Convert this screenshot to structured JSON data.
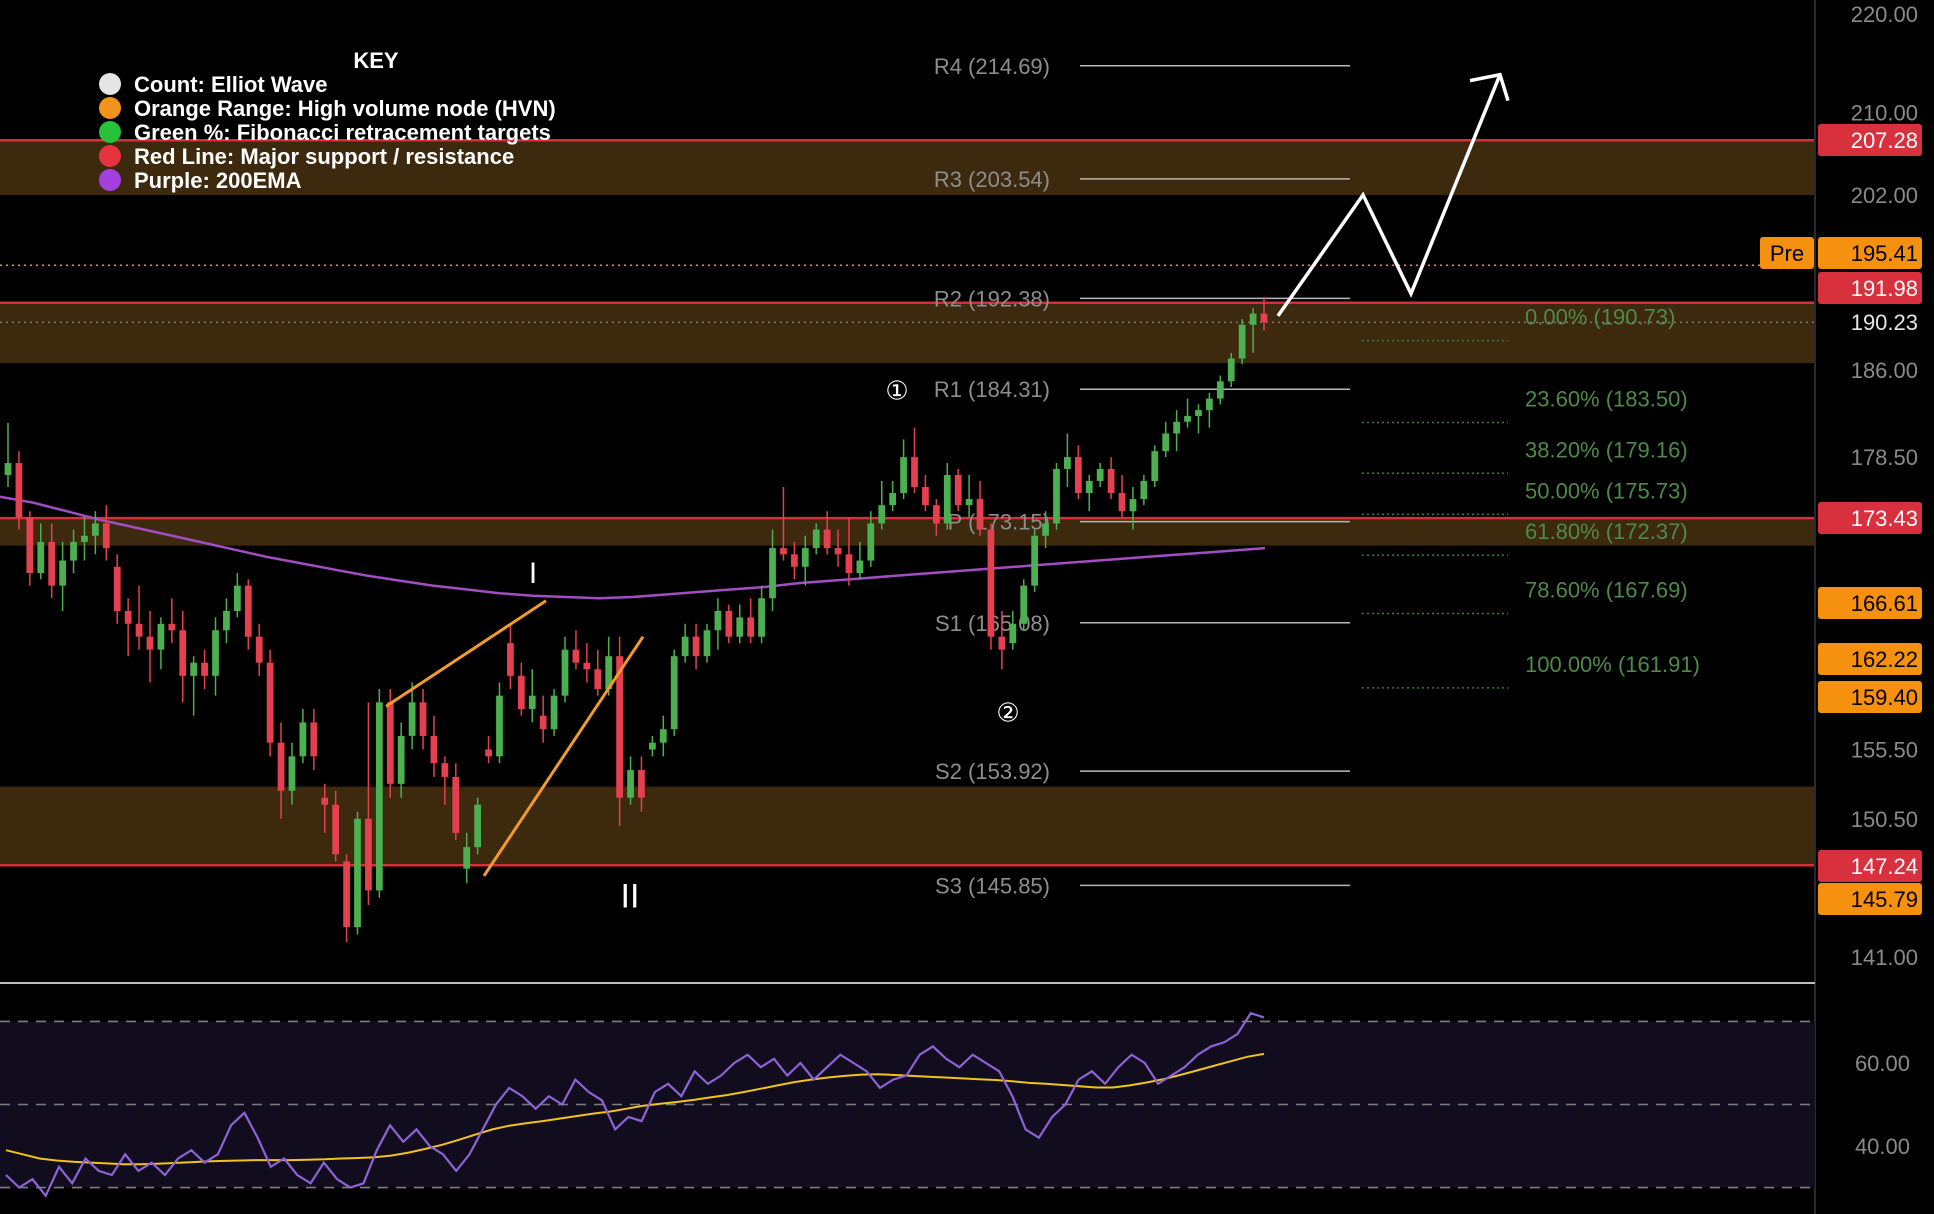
{
  "key": {
    "title": "KEY",
    "items": [
      {
        "color": "#e6e6e6",
        "label": "Count: Elliot Wave"
      },
      {
        "color": "#f2931c",
        "label": "Orange Range: High volume node (HVN)"
      },
      {
        "color": "#27c13a",
        "label": "Green %: Fibonacci retracement targets"
      },
      {
        "color": "#e5333f",
        "label": "Red Line: Major support / resistance"
      },
      {
        "color": "#a43fe0",
        "label": "Purple: 200EMA"
      }
    ]
  },
  "chart_data": {
    "type": "candlestick",
    "price_axis": {
      "ticks": [
        "220.00",
        "210.00",
        "202.00",
        "186.00",
        "178.50",
        "155.50",
        "150.50",
        "141.00"
      ],
      "scale": "log"
    },
    "badges": [
      {
        "value": "207.28",
        "style": "red"
      },
      {
        "value": "195.41",
        "style": "orange",
        "prefix": "Pre"
      },
      {
        "value": "191.98",
        "style": "red"
      },
      {
        "value": "190.23",
        "style": "plain"
      },
      {
        "value": "173.43",
        "style": "red"
      },
      {
        "value": "166.61",
        "style": "orange"
      },
      {
        "value": "162.22",
        "style": "orange"
      },
      {
        "value": "159.40",
        "style": "orange"
      },
      {
        "value": "147.24",
        "style": "red"
      },
      {
        "value": "145.79",
        "style": "orange"
      }
    ],
    "pivots": [
      {
        "label": "R4 (214.69)",
        "value": 214.69
      },
      {
        "label": "R3 (203.54)",
        "value": 203.54
      },
      {
        "label": "R2 (192.38)",
        "value": 192.38
      },
      {
        "label": "R1 (184.31)",
        "value": 184.31
      },
      {
        "label": "P (173.15)",
        "value": 173.15
      },
      {
        "label": "S1 (165.08)",
        "value": 165.08
      },
      {
        "label": "S2 (153.92)",
        "value": 153.92
      },
      {
        "label": "S3 (145.85)",
        "value": 145.85
      }
    ],
    "fibonacci": [
      {
        "label": "0.00% (190.73)",
        "value": 190.73
      },
      {
        "label": "23.60% (183.50)",
        "value": 183.5
      },
      {
        "label": "38.20% (179.16)",
        "value": 179.16
      },
      {
        "label": "50.00% (175.73)",
        "value": 175.73
      },
      {
        "label": "61.80% (172.37)",
        "value": 172.37
      },
      {
        "label": "78.60% (167.69)",
        "value": 167.69
      },
      {
        "label": "100.00% (161.91)",
        "value": 161.91
      }
    ],
    "support_resistance": [
      207.28,
      191.98,
      173.43,
      147.24
    ],
    "hvn_zones": [
      [
        202.0,
        207.28
      ],
      [
        186.6,
        191.98
      ],
      [
        171.2,
        173.43
      ],
      [
        147.24,
        152.8
      ]
    ],
    "premarket_price": 195.41,
    "last_price": 190.23,
    "wave_labels": [
      {
        "text": "I",
        "price": 169.0
      },
      {
        "text": "II",
        "price": 145.0
      },
      {
        "text": "①",
        "price": 184.3
      },
      {
        "text": "②",
        "price": 158.3
      }
    ],
    "candles": [
      [
        177.0,
        181.4,
        176.0,
        178.0
      ],
      [
        178.0,
        179.0,
        172.5,
        173.5
      ],
      [
        173.5,
        174.0,
        168.0,
        169.0
      ],
      [
        169.0,
        173.0,
        168.5,
        171.5
      ],
      [
        171.5,
        173.0,
        167.0,
        168.0
      ],
      [
        168.0,
        171.5,
        166.0,
        170.0
      ],
      [
        170.0,
        172.5,
        169.0,
        171.5
      ],
      [
        171.5,
        173.5,
        170.0,
        172.0
      ],
      [
        172.0,
        174.0,
        170.5,
        173.0
      ],
      [
        173.0,
        174.5,
        170.0,
        171.0
      ],
      [
        169.5,
        170.5,
        165.0,
        166.0
      ],
      [
        166.0,
        167.0,
        162.5,
        165.0
      ],
      [
        165.0,
        168.0,
        163.0,
        164.0
      ],
      [
        164.0,
        166.0,
        160.5,
        163.0
      ],
      [
        163.0,
        165.5,
        161.5,
        165.0
      ],
      [
        165.0,
        167.0,
        163.5,
        164.5
      ],
      [
        164.5,
        166.0,
        159.0,
        161.0
      ],
      [
        161.0,
        162.5,
        158.0,
        162.0
      ],
      [
        162.0,
        163.0,
        160.0,
        161.0
      ],
      [
        161.0,
        165.5,
        159.5,
        164.5
      ],
      [
        164.5,
        167.0,
        163.5,
        166.0
      ],
      [
        166.0,
        169.0,
        165.5,
        168.0
      ],
      [
        168.0,
        168.5,
        163.0,
        164.0
      ],
      [
        164.0,
        165.0,
        161.0,
        162.0
      ],
      [
        162.0,
        163.0,
        155.0,
        156.0
      ],
      [
        156.0,
        157.5,
        150.5,
        152.5
      ],
      [
        152.5,
        156.0,
        151.5,
        155.0
      ],
      [
        155.0,
        158.5,
        154.5,
        157.5
      ],
      [
        157.5,
        158.5,
        154.0,
        155.0
      ],
      [
        152.0,
        153.0,
        149.5,
        151.5
      ],
      [
        151.5,
        152.5,
        147.5,
        148.0
      ],
      [
        147.5,
        148.0,
        142.0,
        143.0
      ],
      [
        143.0,
        151.0,
        142.5,
        150.5
      ],
      [
        150.5,
        159.0,
        144.5,
        145.5
      ],
      [
        145.5,
        160.0,
        145.0,
        159.0
      ],
      [
        159.0,
        160.0,
        152.0,
        153.0
      ],
      [
        153.0,
        157.5,
        152.0,
        156.5
      ],
      [
        156.5,
        160.5,
        155.5,
        159.0
      ],
      [
        159.0,
        160.0,
        155.5,
        156.5
      ],
      [
        156.5,
        158.0,
        153.5,
        154.5
      ],
      [
        154.5,
        155.0,
        151.5,
        153.5
      ],
      [
        153.5,
        154.5,
        149.0,
        149.5
      ],
      [
        147.0,
        149.5,
        146.0,
        148.5
      ],
      [
        148.5,
        152.0,
        148.0,
        151.5
      ],
      [
        155.5,
        156.5,
        154.5,
        155.0
      ],
      [
        155.0,
        160.5,
        154.5,
        159.5
      ],
      [
        163.5,
        165.0,
        160.0,
        161.0
      ],
      [
        161.0,
        162.0,
        158.0,
        158.5
      ],
      [
        158.5,
        161.5,
        157.5,
        159.5
      ],
      [
        158.0,
        159.5,
        156.0,
        157.0
      ],
      [
        157.0,
        160.0,
        156.5,
        159.5
      ],
      [
        159.5,
        164.0,
        159.0,
        163.0
      ],
      [
        163.0,
        164.5,
        161.5,
        162.0
      ],
      [
        162.0,
        163.5,
        160.5,
        161.5
      ],
      [
        161.5,
        163.0,
        159.5,
        160.0
      ],
      [
        160.0,
        164.0,
        159.5,
        162.5
      ],
      [
        162.5,
        164.0,
        150.0,
        152.0
      ],
      [
        152.0,
        155.0,
        151.5,
        154.0
      ],
      [
        154.0,
        155.0,
        151.0,
        152.0
      ],
      [
        155.5,
        156.5,
        155.0,
        156.0
      ],
      [
        156.0,
        158.0,
        155.0,
        157.0
      ],
      [
        157.0,
        163.0,
        156.5,
        162.5
      ],
      [
        162.5,
        165.0,
        162.0,
        164.0
      ],
      [
        164.0,
        165.0,
        161.5,
        162.5
      ],
      [
        162.5,
        165.0,
        162.0,
        164.5
      ],
      [
        164.5,
        167.0,
        163.0,
        166.0
      ],
      [
        166.0,
        166.5,
        163.5,
        164.0
      ],
      [
        164.0,
        166.5,
        163.5,
        165.5
      ],
      [
        165.5,
        167.0,
        163.5,
        164.0
      ],
      [
        164.0,
        168.0,
        163.5,
        167.0
      ],
      [
        167.0,
        172.5,
        166.0,
        171.0
      ],
      [
        171.0,
        176.0,
        170.0,
        170.5
      ],
      [
        170.5,
        171.5,
        168.5,
        169.5
      ],
      [
        169.5,
        172.0,
        168.0,
        171.0
      ],
      [
        171.0,
        173.0,
        170.5,
        172.5
      ],
      [
        172.5,
        174.0,
        170.5,
        171.0
      ],
      [
        171.0,
        172.5,
        169.5,
        170.5
      ],
      [
        170.5,
        173.5,
        168.0,
        169.0
      ],
      [
        169.0,
        171.5,
        168.5,
        170.0
      ],
      [
        170.0,
        174.0,
        169.5,
        173.0
      ],
      [
        173.0,
        176.5,
        172.5,
        174.5
      ],
      [
        174.5,
        176.5,
        174.0,
        175.5
      ],
      [
        175.5,
        180.0,
        175.0,
        178.5
      ],
      [
        178.5,
        181.0,
        175.5,
        176.0
      ],
      [
        176.0,
        177.0,
        174.0,
        174.5
      ],
      [
        174.5,
        175.0,
        172.0,
        173.0
      ],
      [
        173.0,
        178.0,
        172.5,
        177.0
      ],
      [
        177.0,
        177.5,
        174.0,
        174.5
      ],
      [
        174.5,
        177.0,
        173.5,
        175.0
      ],
      [
        175.0,
        176.5,
        172.0,
        172.5
      ],
      [
        172.5,
        173.0,
        163.0,
        164.0
      ],
      [
        164.0,
        166.0,
        161.5,
        163.0
      ],
      [
        163.5,
        166.0,
        163.0,
        165.0
      ],
      [
        165.0,
        168.5,
        164.5,
        168.0
      ],
      [
        168.0,
        172.5,
        167.5,
        172.0
      ],
      [
        172.0,
        174.0,
        171.0,
        173.0
      ],
      [
        173.0,
        178.0,
        172.5,
        177.5
      ],
      [
        177.5,
        180.5,
        176.0,
        178.5
      ],
      [
        178.5,
        179.5,
        175.0,
        175.5
      ],
      [
        175.5,
        177.0,
        174.0,
        176.5
      ],
      [
        176.5,
        178.0,
        176.0,
        177.5
      ],
      [
        177.5,
        178.5,
        175.0,
        175.5
      ],
      [
        175.5,
        177.0,
        173.5,
        174.0
      ],
      [
        174.0,
        176.0,
        172.5,
        175.0
      ],
      [
        175.0,
        177.0,
        174.5,
        176.5
      ],
      [
        176.5,
        179.5,
        176.0,
        179.0
      ],
      [
        179.0,
        181.5,
        178.5,
        180.5
      ],
      [
        180.5,
        182.5,
        179.0,
        181.5
      ],
      [
        181.5,
        183.5,
        181.0,
        182.0
      ],
      [
        182.0,
        183.0,
        180.5,
        182.5
      ],
      [
        182.5,
        184.0,
        181.0,
        183.5
      ],
      [
        183.5,
        185.5,
        183.0,
        185.0
      ],
      [
        185.0,
        187.5,
        184.5,
        187.0
      ],
      [
        187.0,
        190.5,
        186.5,
        190.0
      ],
      [
        190.0,
        191.5,
        187.5,
        191.0
      ],
      [
        191.0,
        192.5,
        189.5,
        190.23
      ]
    ],
    "ema200": [
      175.2,
      174.7,
      174.0,
      173.3,
      172.7,
      172.1,
      171.5,
      170.9,
      170.3,
      169.8,
      169.3,
      168.8,
      168.4,
      168.0,
      167.7,
      167.4,
      167.2,
      167.1,
      167.0,
      167.1,
      167.3,
      167.5,
      167.7,
      167.9,
      168.2,
      168.4,
      168.6,
      168.8,
      169.0,
      169.2,
      169.4,
      169.6,
      169.8,
      170.0,
      170.2,
      170.4,
      170.6,
      170.8,
      171.0
    ],
    "projection": [
      [
        190.8,
        1
      ],
      [
        202.0,
        1
      ],
      [
        192.8,
        1
      ],
      [
        213.8,
        1
      ]
    ],
    "rsi": {
      "ticks": [
        "60.00",
        "40.00"
      ],
      "levels": [
        70,
        50,
        30
      ],
      "rsi_values": [
        33,
        30,
        32,
        28,
        35,
        31,
        37,
        34,
        33,
        38,
        34,
        36,
        33,
        37,
        39,
        36,
        38,
        45,
        48,
        42,
        35,
        37,
        33,
        31,
        36,
        32,
        30,
        31,
        39,
        45,
        41,
        44,
        40,
        38,
        34,
        38,
        44,
        50,
        54,
        52,
        49,
        52,
        50,
        56,
        53,
        51,
        44,
        47,
        46,
        53,
        55,
        52,
        58,
        55,
        57,
        60,
        62,
        59,
        61,
        57,
        60,
        56,
        59,
        62,
        60,
        58,
        54,
        56,
        57,
        62,
        64,
        61,
        59,
        62,
        60,
        58,
        52,
        44,
        42,
        47,
        50,
        56,
        58,
        55,
        59,
        62,
        60,
        55,
        57,
        59,
        62,
        64,
        65,
        67,
        72,
        71
      ],
      "ma_values": [
        39,
        38,
        37,
        36.5,
        36.2,
        36,
        35.8,
        35.6,
        35.6,
        35.7,
        35.9,
        36.1,
        36.3,
        36.4,
        36.5,
        36.6,
        36.6,
        36.6,
        36.7,
        36.8,
        37.0,
        37.1,
        37.3,
        37.7,
        38.4,
        39.3,
        40.3,
        41.5,
        42.8,
        44.0,
        44.9,
        45.5,
        46.0,
        46.6,
        47.2,
        47.8,
        48.3,
        49.0,
        49.7,
        50.2,
        50.6,
        51.1,
        51.7,
        52.3,
        53.0,
        53.8,
        54.6,
        55.4,
        56.0,
        56.5,
        56.9,
        57.2,
        57.3,
        57.1,
        56.9,
        56.7,
        56.5,
        56.3,
        56.1,
        55.9,
        55.6,
        55.2,
        55.0,
        54.7,
        54.4,
        54.1,
        54.1,
        54.6,
        55.3,
        56.1,
        57.1,
        58.2,
        59.3,
        60.4,
        61.5,
        62.2
      ]
    }
  }
}
